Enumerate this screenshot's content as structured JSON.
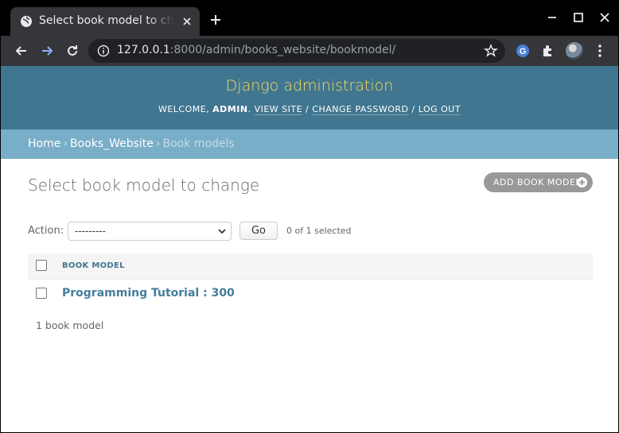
{
  "browser": {
    "tab_title": "Select book model to change",
    "url_host": "127.0.0.1",
    "url_rest": ":8000/admin/books_website/bookmodel/"
  },
  "header": {
    "brand": "Django administration",
    "welcome": "Welcome,",
    "username": "admin",
    "view_site": "View site",
    "change_password": "Change password",
    "log_out": "Log out"
  },
  "breadcrumbs": {
    "home": "Home",
    "app": "Books_Website",
    "current": "Book models",
    "separator": "›"
  },
  "main": {
    "title": "Select book model to change",
    "add_button": "Add book model",
    "action_label": "Action:",
    "action_value": "---------",
    "go_button": "Go",
    "selected_counter": "0 of 1 selected",
    "column_header": "Book model",
    "rows": [
      {
        "label": "Programming Tutorial : 300"
      }
    ],
    "paginator": "1 book model"
  },
  "colors": {
    "header_bg": "#417690",
    "brand_yellow": "#f5dd5d",
    "breadcrumbs_bg": "#79aec8",
    "link": "#447e9b",
    "add_button_bg": "#999999"
  }
}
